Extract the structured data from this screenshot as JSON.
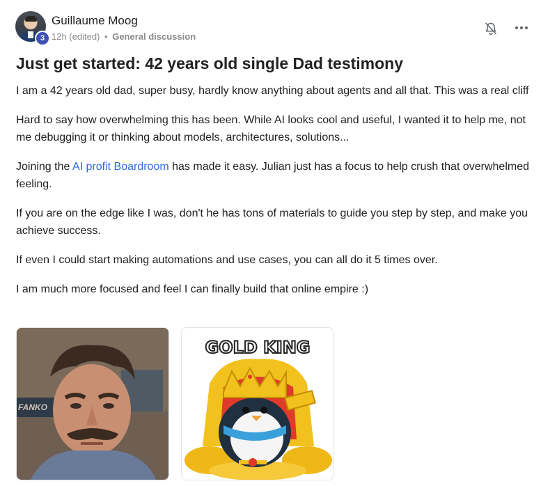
{
  "post": {
    "author": "Guillaume Moog",
    "level": "3",
    "time": "12h (edited)",
    "separator": "•",
    "category": "General discussion",
    "title": "Just get started: 42 years old single Dad testimony",
    "paragraphs": [
      "I am a 42 years old dad, super busy, hardly know anything about agents and all that. This was a real cliff",
      "Hard to say how overwhelming this has been. While AI looks cool and useful, I wanted it to help me, not me debugging it or thinking about models, architectures, solutions...",
      {
        "before": "Joining the ",
        "link": "AI profit Boardroom",
        "after": " has made it easy. Julian just has a focus to help crush that overwhelmed feeling."
      },
      "If you are on the edge like I was, don't he has tons of materials to guide you step by step, and make you achieve success.",
      "If even I could start making automations and use cases, you can all do it 5 times over.",
      "I am much more focused and feel I can finally build that online empire :)"
    ]
  },
  "media": {
    "thumb1_caption": "FANKO",
    "thumb2_caption": "GOLD KING"
  },
  "colors": {
    "link": "#2d6ae3",
    "badge": "#3f51b5",
    "meta": "#8a8a8a"
  },
  "icons": [
    "bell-off-icon",
    "more-options-icon"
  ]
}
